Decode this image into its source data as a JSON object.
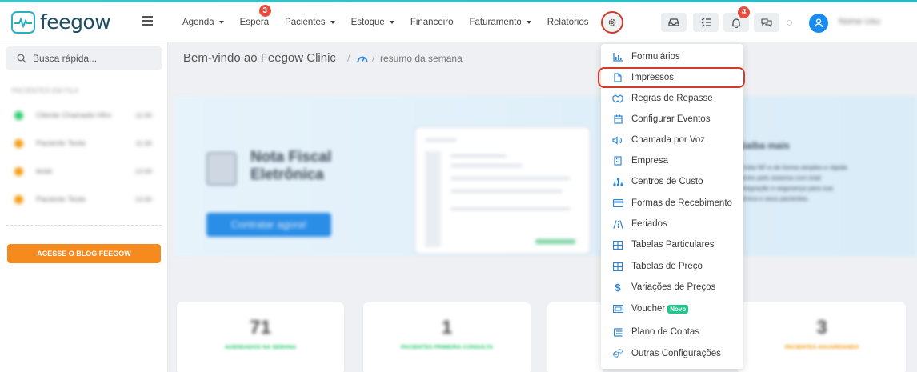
{
  "header": {
    "logo_text": "feegow",
    "nav": [
      {
        "label": "Agenda",
        "has_caret": true
      },
      {
        "label": "Espera",
        "has_caret": false,
        "badge": "3"
      },
      {
        "label": "Pacientes",
        "has_caret": true
      },
      {
        "label": "Estoque",
        "has_caret": true
      },
      {
        "label": "Financeiro",
        "has_caret": false
      },
      {
        "label": "Faturamento",
        "has_caret": true
      },
      {
        "label": "Relatórios",
        "has_caret": false
      }
    ],
    "notifications_badge": "4",
    "user_name": "Nome Usu"
  },
  "sidebar": {
    "search_placeholder": "Busca rápida...",
    "section_title": "PACIENTES EM FILA",
    "queue": [
      {
        "name": "Cliente Chamado Hfro",
        "time": "11:00",
        "color": "#2ecc71"
      },
      {
        "name": "Paciente Teste",
        "time": "11:30",
        "color": "#f39c12"
      },
      {
        "name": "teste",
        "time": "12:00",
        "color": "#f39c12"
      },
      {
        "name": "Paciente Teste",
        "time": "13:30",
        "color": "#f39c12"
      }
    ],
    "blog_button": "ACESSE O BLOG FEEGOW"
  },
  "main": {
    "welcome": "Bem-vindo ao Feegow Clinic",
    "breadcrumb": "resumo da semana",
    "banner": {
      "title_line1": "Nota Fiscal",
      "title_line2": "Eletrônica",
      "cta": "Contratar agora!",
      "right_title": "Saiba mais",
      "right_text": [
        "Emita NF-e de forma simples e rápida",
        "direto pelo sistema com total",
        "integração e segurança para sua",
        "clínica e seus pacientes."
      ]
    },
    "stats": [
      {
        "value": "71",
        "label": "AGENDADOS NA SEMANA",
        "color": "#2ecc71"
      },
      {
        "value": "1",
        "label": "PACIENTES PRIMEIRA CONSULTA",
        "color": "#2ecc71"
      },
      {
        "value": "",
        "label": "",
        "color": "#3498db"
      },
      {
        "value": "3",
        "label": "PACIENTES AGUARDANDO",
        "color": "#f39c12"
      }
    ]
  },
  "settings_menu": {
    "items": [
      {
        "label": "Formulários",
        "icon": "bar-chart-icon"
      },
      {
        "label": "Impressos",
        "icon": "document-icon"
      },
      {
        "label": "Regras de Repasse",
        "icon": "handshake-icon"
      },
      {
        "label": "Configurar Eventos",
        "icon": "calendar-icon"
      },
      {
        "label": "Chamada por Voz",
        "icon": "speaker-icon"
      },
      {
        "label": "Empresa",
        "icon": "building-icon"
      },
      {
        "label": "Centros de Custo",
        "icon": "sitemap-icon"
      },
      {
        "label": "Formas de Recebimento",
        "icon": "credit-card-icon"
      },
      {
        "label": "Feriados",
        "icon": "road-icon"
      },
      {
        "label": "Tabelas Particulares",
        "icon": "table-icon"
      },
      {
        "label": "Tabelas de Preço",
        "icon": "table-icon"
      },
      {
        "label": "Variações de Preços",
        "icon": "dollar-icon"
      },
      {
        "label": "Voucher",
        "icon": "ticket-icon",
        "badge": "Novo"
      },
      {
        "label": "Plano de Contas",
        "icon": "list-icon"
      },
      {
        "label": "Outras Configurações",
        "icon": "cogs-icon"
      }
    ],
    "highlighted": "Impressos"
  },
  "colors": {
    "accent": "#29b0c3",
    "icon_blue": "#2f86d8",
    "highlight_red": "#d13b2b",
    "blog_orange": "#f58a1f",
    "avatar_blue": "#1a8cf0"
  }
}
